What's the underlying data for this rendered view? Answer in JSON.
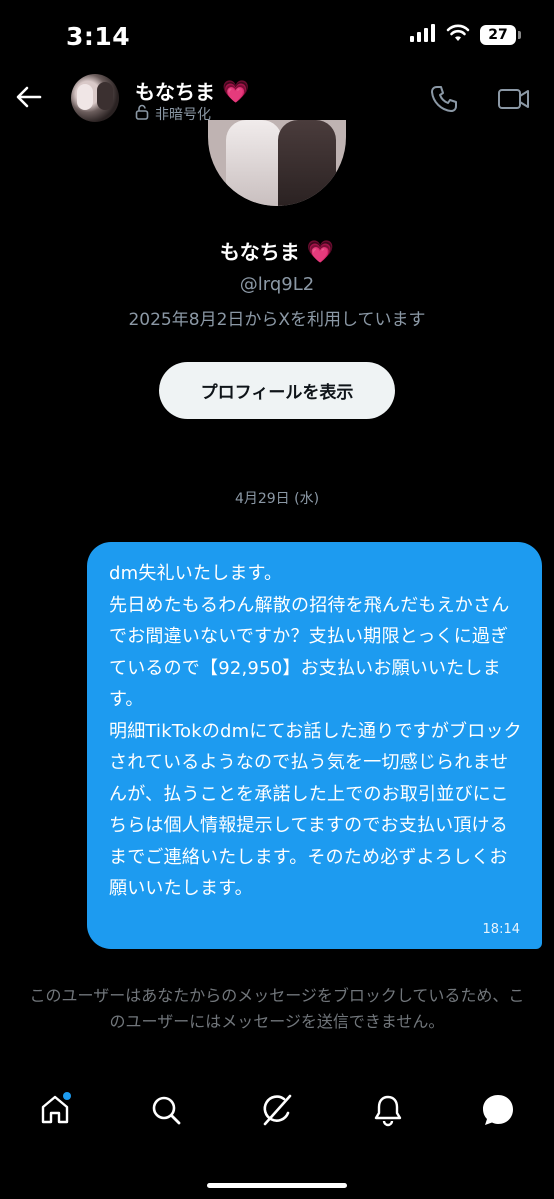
{
  "status_bar": {
    "time": "3:14",
    "battery": "27"
  },
  "header": {
    "name": "もなちま",
    "name_emoji": "💗",
    "encryption_status": "非暗号化"
  },
  "profile": {
    "name": "もなちま",
    "name_emoji": "💗",
    "handle": "@lrq9L2",
    "joined": "2025年8月2日からXを利用しています",
    "view_profile_button": "プロフィールを表示"
  },
  "conversation": {
    "date_separator": "4月29日 (水)",
    "messages": [
      {
        "text": "dm失礼いたします。\n先日めたもるわん解散の招待を飛んだもえかさんでお間違いないですか？支払い期限とっくに過ぎているので【92,950】お支払いお願いいたします。\n明細TikTokのdmにてお話した通りですがブロックされているようなので払う気を一切感じられませんが、払うことを承諾した上でのお取引並びにこちらは個人情報提示してますのでお支払い頂けるまでご連絡いたします。そのため必ずよろしくお願いいたします。",
        "time": "18:14"
      }
    ],
    "blocked_notice": "このユーザーはあなたからのメッセージをブロックしているため、このユーザーにはメッセージを送信できません。"
  },
  "colors": {
    "bubble": "#1d9bf0",
    "background": "#000000",
    "muted_text": "#8b98a5",
    "notification_dot": "#1d9bf0"
  },
  "nav": {
    "items": [
      "home-icon",
      "search-icon",
      "grok-icon",
      "notifications-icon",
      "messages-icon"
    ]
  }
}
